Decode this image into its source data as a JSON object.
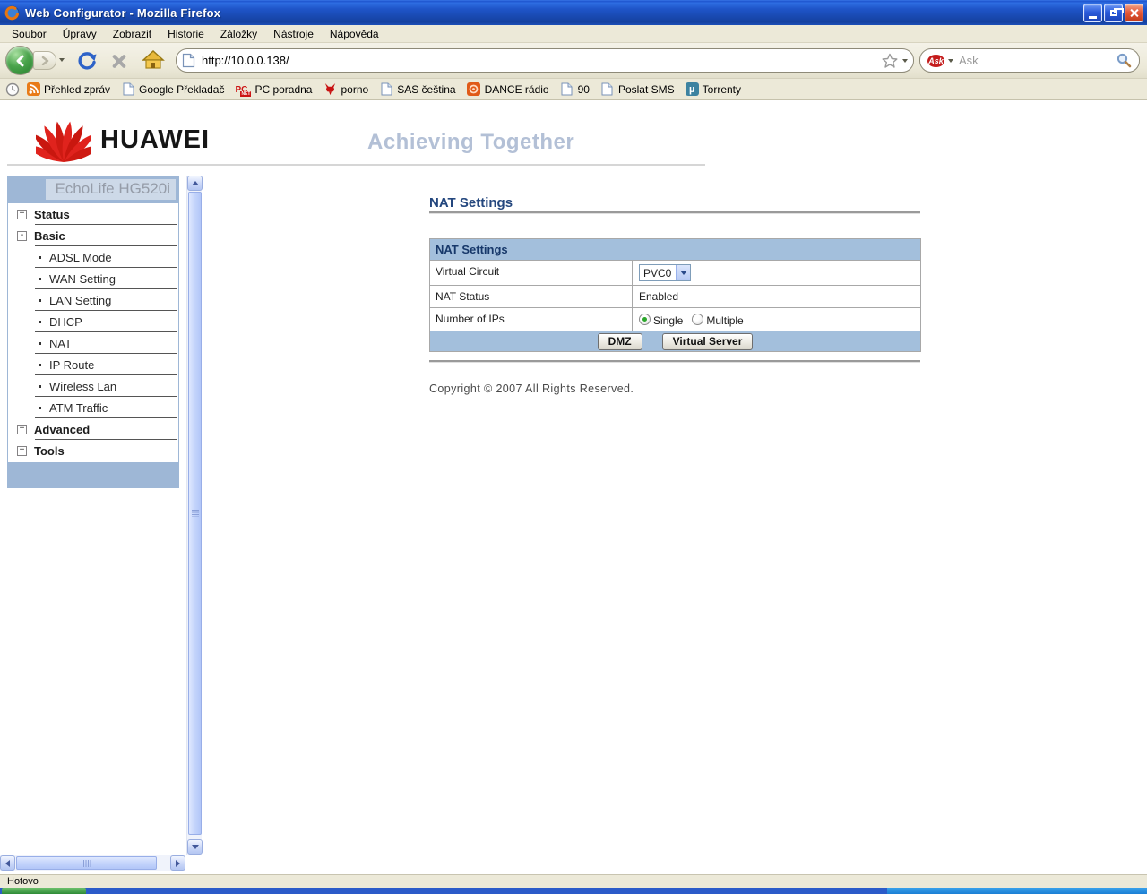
{
  "window": {
    "title": "Web Configurator - Mozilla Firefox"
  },
  "menubar": {
    "items": [
      {
        "pre": "",
        "key": "S",
        "post": "oubor"
      },
      {
        "pre": "Úpr",
        "key": "a",
        "post": "vy"
      },
      {
        "pre": "",
        "key": "Z",
        "post": "obrazit"
      },
      {
        "pre": "",
        "key": "H",
        "post": "istorie"
      },
      {
        "pre": "Zál",
        "key": "o",
        "post": "žky"
      },
      {
        "pre": "",
        "key": "N",
        "post": "ástroje"
      },
      {
        "pre": "Nápo",
        "key": "v",
        "post": "ěda"
      }
    ]
  },
  "toolbar": {
    "url": "http://10.0.0.138/",
    "search_placeholder": "Ask"
  },
  "bookmarks": {
    "items": [
      {
        "icon": "rss-icon",
        "label": "Přehled zpráv"
      },
      {
        "icon": "page-icon",
        "label": "Google Překladač"
      },
      {
        "icon": "pcnet-icon",
        "label": "PC poradna"
      },
      {
        "icon": "devil-icon",
        "label": "porno"
      },
      {
        "icon": "page-icon",
        "label": "SAS čeština"
      },
      {
        "icon": "dance-icon",
        "label": "DANCE rádio"
      },
      {
        "icon": "page-icon",
        "label": "90"
      },
      {
        "icon": "page-icon",
        "label": "Poslat SMS"
      },
      {
        "icon": "utorrent-icon",
        "label": "Torrenty"
      }
    ],
    "pcnet_top": "PC",
    "pcnet_bottom": "NET",
    "utorrent_glyph": "µ",
    "ask_logo": "Ask"
  },
  "banner": {
    "brand": "HUAWEI",
    "slogan": "Achieving Together"
  },
  "sidebar": {
    "device": "EchoLife HG520i",
    "items": [
      {
        "label": "Status",
        "expander": "+"
      },
      {
        "label": "Basic",
        "expander": "-"
      },
      {
        "label": "ADSL Mode"
      },
      {
        "label": "WAN Setting"
      },
      {
        "label": "LAN Setting"
      },
      {
        "label": "DHCP"
      },
      {
        "label": "NAT"
      },
      {
        "label": "IP Route"
      },
      {
        "label": "Wireless Lan"
      },
      {
        "label": "ATM Traffic"
      },
      {
        "label": "Advanced",
        "expander": "+"
      },
      {
        "label": "Tools",
        "expander": "+"
      }
    ]
  },
  "main": {
    "page_title": "NAT Settings",
    "table": {
      "header": "NAT Settings",
      "virtual_circuit_label": "Virtual Circuit",
      "virtual_circuit_value": "PVC0",
      "nat_status_label": "NAT Status",
      "nat_status_value": "Enabled",
      "num_ips_label": "Number of IPs",
      "radio_single": "Single",
      "radio_multiple": "Multiple"
    },
    "dmz_button": "DMZ",
    "virtual_server_button": "Virtual Server",
    "copyright": "Copyright © 2007 All Rights Reserved."
  },
  "statusbar": {
    "text": "Hotovo"
  },
  "colors": {
    "table_blue": "#a3bfdc",
    "sidebar_blue": "#9eb7d6",
    "title_navy": "#24477e",
    "xp_beige": "#ece9d8"
  }
}
